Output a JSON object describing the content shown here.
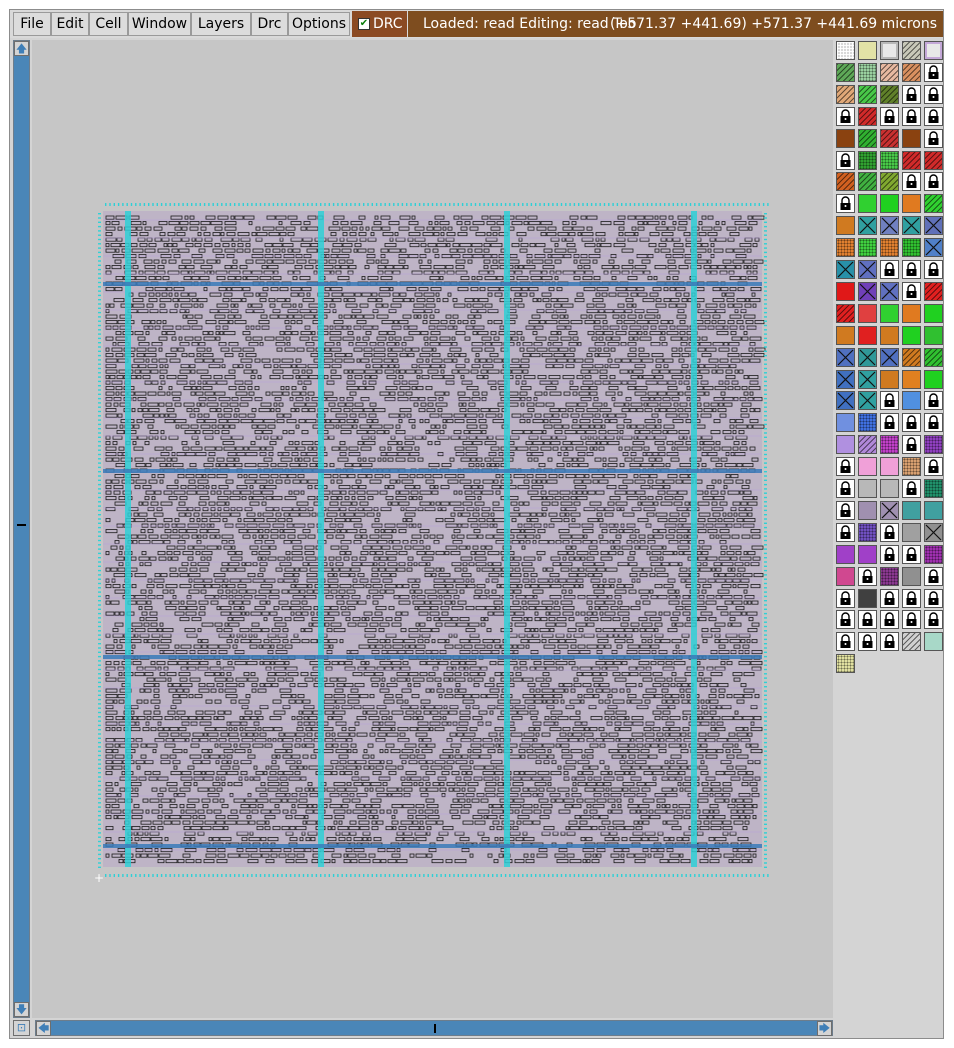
{
  "menu": {
    "file": "File",
    "edit": "Edit",
    "cell": "Cell",
    "window": "Window",
    "layers": "Layers",
    "drc": "Drc",
    "options": "Options"
  },
  "drc_toggle": {
    "label": "DRC",
    "checked": true,
    "check_glyph": "✔"
  },
  "status": {
    "message": "Loaded: read Editing: read Too",
    "coords": "(+571.37 +441.69) +571.37 +441.69 microns"
  },
  "scroll": {
    "up": "🡅",
    "down": "🡇",
    "left": "🡄",
    "right": "🡆",
    "corner": "⊡"
  },
  "colors": {
    "menubar": "#d9d9d9",
    "status_bg": "#7e4d1f",
    "drc_bg": "#8b4a23",
    "canvas_bg": "#c6c6c6",
    "die_fill": "#beb4c6",
    "cyan_track": "#2fd0d6",
    "blue_strap": "#3a7ab8",
    "scrollbar": "#4a86b8"
  },
  "layer_palette": {
    "columns": 5,
    "swatches": [
      [
        "grid",
        "#d8d8d8"
      ],
      [
        "solid",
        "#e2e2a6"
      ],
      [
        "outline",
        "#b8b8b8"
      ],
      [
        "hatch",
        "#c8c8b8"
      ],
      [
        "outline",
        "#c4a8d8"
      ],
      [
        "hatch",
        "#5ea858"
      ],
      [
        "dots",
        "#9ad0a0"
      ],
      [
        "hatch",
        "#e6b8a0"
      ],
      [
        "hatch",
        "#d89060"
      ],
      [
        "lock",
        "#ffffff"
      ],
      [
        "hatch",
        "#e0a878"
      ],
      [
        "hatch",
        "#48c848"
      ],
      [
        "hatch",
        "#60802a"
      ],
      [
        "lock",
        "#ffffff"
      ],
      [
        "lock",
        "#ffffff"
      ],
      [
        "lock",
        "#ffffff"
      ],
      [
        "hatch",
        "#d02a2a"
      ],
      [
        "lock",
        "#ffffff"
      ],
      [
        "lock",
        "#ffffff"
      ],
      [
        "lock",
        "#ffffff"
      ],
      [
        "solid",
        "#8a4210"
      ],
      [
        "hatch",
        "#30b030"
      ],
      [
        "hatch",
        "#c83030"
      ],
      [
        "solid",
        "#8a4210"
      ],
      [
        "lock",
        "#ffffff"
      ],
      [
        "lock",
        "#ffffff"
      ],
      [
        "dots",
        "#30a030"
      ],
      [
        "dots",
        "#48c848"
      ],
      [
        "hatch",
        "#d02a2a"
      ],
      [
        "hatch",
        "#d02a2a"
      ],
      [
        "hatch",
        "#d06020"
      ],
      [
        "hatch",
        "#40b040"
      ],
      [
        "hatch",
        "#80a830"
      ],
      [
        "lock",
        "#ffffff"
      ],
      [
        "lock",
        "#ffffff"
      ],
      [
        "lock",
        "#ffffff"
      ],
      [
        "solid",
        "#30d030"
      ],
      [
        "solid",
        "#20d020"
      ],
      [
        "solid",
        "#e07a20"
      ],
      [
        "hatch",
        "#30d030"
      ],
      [
        "solid",
        "#d07a20"
      ],
      [
        "cross",
        "#30a0a0"
      ],
      [
        "cross",
        "#7080c0"
      ],
      [
        "cross",
        "#30a0a0"
      ],
      [
        "cross",
        "#6070b8"
      ],
      [
        "dots",
        "#e08030"
      ],
      [
        "dots",
        "#40d040"
      ],
      [
        "dots",
        "#e08030"
      ],
      [
        "dots",
        "#30c030"
      ],
      [
        "cross",
        "#5080c8"
      ],
      [
        "cross",
        "#2890a8"
      ],
      [
        "cross",
        "#6070c0"
      ],
      [
        "lock",
        "#ffffff"
      ],
      [
        "lock",
        "#ffffff"
      ],
      [
        "lock",
        "#ffffff"
      ],
      [
        "solid",
        "#e01818"
      ],
      [
        "cross",
        "#7040b8"
      ],
      [
        "cross",
        "#6070c0"
      ],
      [
        "lock",
        "#ffffff"
      ],
      [
        "hatch",
        "#e02020"
      ],
      [
        "hatch",
        "#e02020"
      ],
      [
        "solid",
        "#e04040"
      ],
      [
        "solid",
        "#30d030"
      ],
      [
        "solid",
        "#e07a20"
      ],
      [
        "solid",
        "#20d020"
      ],
      [
        "solid",
        "#d07a20"
      ],
      [
        "solid",
        "#e02020"
      ],
      [
        "solid",
        "#d07a20"
      ],
      [
        "solid",
        "#20d020"
      ],
      [
        "solid",
        "#30c030"
      ],
      [
        "cross",
        "#5070c0"
      ],
      [
        "cross",
        "#309898"
      ],
      [
        "cross",
        "#5070c0"
      ],
      [
        "hatch",
        "#d07a20"
      ],
      [
        "hatch",
        "#30c030"
      ],
      [
        "cross",
        "#4070c0"
      ],
      [
        "cross",
        "#30a0a0"
      ],
      [
        "solid",
        "#d07a20"
      ],
      [
        "solid",
        "#e08020"
      ],
      [
        "solid",
        "#20d020"
      ],
      [
        "cross",
        "#4070c0"
      ],
      [
        "cross",
        "#30a0a0"
      ],
      [
        "lock",
        "#ffffff"
      ],
      [
        "solid",
        "#5090e0"
      ],
      [
        "lock",
        "#ffffff"
      ],
      [
        "solid",
        "#7090e0"
      ],
      [
        "dots",
        "#4070e0"
      ],
      [
        "lock",
        "#ffffff"
      ],
      [
        "lock",
        "#ffffff"
      ],
      [
        "lock",
        "#ffffff"
      ],
      [
        "solid",
        "#b090e0"
      ],
      [
        "hatch",
        "#b088d8"
      ],
      [
        "dots",
        "#c040c8"
      ],
      [
        "lock",
        "#ffffff"
      ],
      [
        "dots",
        "#9040c0"
      ],
      [
        "lock",
        "#ffffff"
      ],
      [
        "solid",
        "#f0a0d8"
      ],
      [
        "solid",
        "#f0a0d8"
      ],
      [
        "dots",
        "#d8a070"
      ],
      [
        "lock",
        "#ffffff"
      ],
      [
        "lock",
        "#ffffff"
      ],
      [
        "solid",
        "#b8b8b8"
      ],
      [
        "solid",
        "#b8b8b8"
      ],
      [
        "lock",
        "#ffffff"
      ],
      [
        "dots",
        "#20906a"
      ],
      [
        "lock",
        "#ffffff"
      ],
      [
        "solid",
        "#a090b0"
      ],
      [
        "cross",
        "#a090b0"
      ],
      [
        "solid",
        "#40a0a0"
      ],
      [
        "solid",
        "#40a0a0"
      ],
      [
        "lock",
        "#ffffff"
      ],
      [
        "dots",
        "#7050c0"
      ],
      [
        "lock",
        "#ffffff"
      ],
      [
        "solid",
        "#a0a0a0"
      ],
      [
        "cross",
        "#909090"
      ],
      [
        "solid",
        "#a040c8"
      ],
      [
        "solid",
        "#a040c8"
      ],
      [
        "lock",
        "#ffffff"
      ],
      [
        "lock",
        "#ffffff"
      ],
      [
        "dots",
        "#a030b0"
      ],
      [
        "solid",
        "#d04890"
      ],
      [
        "lock",
        "#ffffff"
      ],
      [
        "dots",
        "#8a3890"
      ],
      [
        "solid",
        "#909090"
      ],
      [
        "lock",
        "#ffffff"
      ],
      [
        "lock",
        "#ffffff"
      ],
      [
        "solid",
        "#404040"
      ],
      [
        "lock",
        "#ffffff"
      ],
      [
        "lock",
        "#ffffff"
      ],
      [
        "lock",
        "#ffffff"
      ],
      [
        "lock",
        "#ffffff"
      ],
      [
        "lock",
        "#ffffff"
      ],
      [
        "lock",
        "#ffffff"
      ],
      [
        "lock",
        "#ffffff"
      ],
      [
        "lock",
        "#ffffff"
      ],
      [
        "lock",
        "#ffffff"
      ],
      [
        "lock",
        "#ffffff"
      ],
      [
        "lock",
        "#ffffff"
      ],
      [
        "hatch",
        "#d0d0d0"
      ],
      [
        "solid",
        "#a8d8c8"
      ],
      [
        "dots",
        "#e0e0a0"
      ]
    ]
  }
}
